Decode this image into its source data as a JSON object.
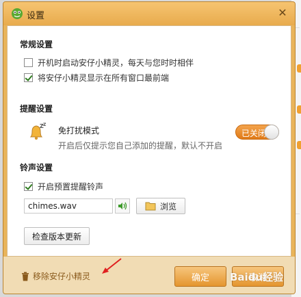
{
  "window": {
    "title": "设置"
  },
  "general": {
    "section_title": "常规设置",
    "autostart_label": "开机时启动安仔小精灵，每天与您时时相伴",
    "autostart_checked": false,
    "ontop_label": "将安仔小精灵显示在所有窗口最前端",
    "ontop_checked": true
  },
  "reminder": {
    "section_title": "提醒设置",
    "dnd_title": "免打扰模式",
    "dnd_desc": "开启后仅提示您自己添加的提醒，默认不开启",
    "dnd_toggle_label": "已关闭"
  },
  "ringtone": {
    "section_title": "铃声设置",
    "preset_label": "开启预置提醒铃声",
    "preset_checked": true,
    "sound_file": "chimes.wav",
    "browse_label": "浏览"
  },
  "update": {
    "check_label": "检查版本更新"
  },
  "footer": {
    "remove_label": "移除安仔小精灵",
    "ok_label": "确定",
    "cancel_label": "取消"
  },
  "watermark": {
    "text": "Baidu经验"
  },
  "colors": {
    "accent_orange": "#e9b45a",
    "toggle_orange": "#e07a17",
    "check_green": "#2f7c1f",
    "footer_bg": "#f1dcb4",
    "annotation_red": "#e02020"
  }
}
